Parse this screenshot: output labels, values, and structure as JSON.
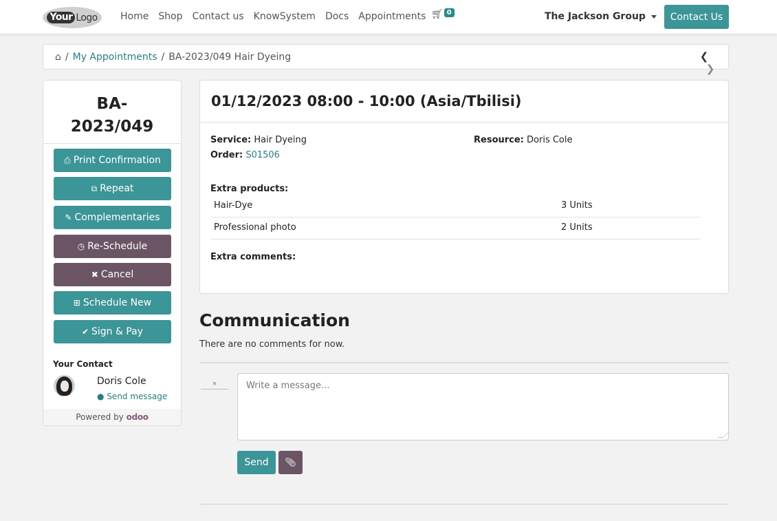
{
  "header": {
    "logo_bold": "Your",
    "logo_light": "Logo",
    "nav": [
      "Home",
      "Shop",
      "Contact us",
      "KnowSystem",
      "Docs",
      "Appointments"
    ],
    "cart_icon": "cart-icon",
    "cart_count": "0",
    "company": "The Jackson Group",
    "contact_button": "Contact Us"
  },
  "breadcrumb": {
    "home_icon": "home-icon",
    "sep": "/",
    "parent": "My Appointments",
    "current": "BA-2023/049 Hair Dyeing",
    "prev_icon": "chevron-left-icon",
    "next_icon": "chevron-right-icon"
  },
  "sidebar": {
    "title_line1": "BA-",
    "title_line2": "2023/049",
    "buttons": [
      {
        "label": "Print Confirmation",
        "icon": "print-icon"
      },
      {
        "label": "Repeat",
        "icon": "copy-icon"
      },
      {
        "label": "Complementaries",
        "icon": "edit-icon"
      },
      {
        "label": "Re-Schedule",
        "icon": "clock-icon"
      },
      {
        "label": "Cancel",
        "icon": "close-icon"
      },
      {
        "label": "Schedule New",
        "icon": "plus-square-icon"
      },
      {
        "label": "Sign & Pay",
        "icon": "check-icon"
      }
    ],
    "your_contact": "Your Contact",
    "contact_name": "Doris Cole",
    "send_message": "Send message",
    "powered_by": "Powered by",
    "powered_brand": "odoo"
  },
  "appointment": {
    "datetime": "01/12/2023 08:00 - 10:00 (Asia/Tbilisi)",
    "service_label": "Service:",
    "service_value": "Hair Dyeing",
    "resource_label": "Resource:",
    "resource_value": "Doris Cole",
    "order_label": "Order:",
    "order_value": "S01506",
    "extra_products_label": "Extra products:",
    "products": [
      {
        "name": "Hair-Dye",
        "qty": "3 Units"
      },
      {
        "name": "Professional photo",
        "qty": "2 Units"
      }
    ],
    "extra_comments_label": "Extra comments:"
  },
  "communication": {
    "title": "Communication",
    "empty_text": "There are no comments for now.",
    "placeholder": "Write a message...",
    "send_label": "Send",
    "attach_icon": "paperclip-icon"
  },
  "colors": {
    "accent": "#3c9597",
    "secondary": "#6b5564",
    "link": "#2b7b80"
  }
}
